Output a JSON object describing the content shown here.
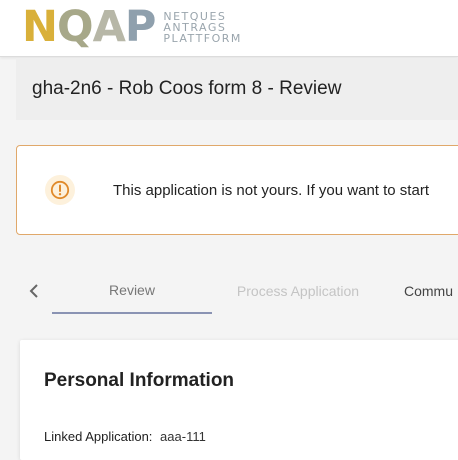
{
  "logo": {
    "letters": [
      "N",
      "Q",
      "A",
      "P"
    ],
    "text_lines": [
      "NETQUES",
      "ANTRAGS",
      "PLATTFORM"
    ],
    "colors": [
      "#d9b03a",
      "#a7a889",
      "#b7b7a7",
      "#8fa0ad"
    ]
  },
  "page": {
    "title": "gha-2n6 - Rob Coos form 8 - Review"
  },
  "alert": {
    "icon": "info-icon",
    "message": "This application is not yours. If you want to start",
    "accent_color": "#e0a86a"
  },
  "tabs": {
    "prev_icon": "chevron-left-icon",
    "items": [
      {
        "label": "Review",
        "state": "active"
      },
      {
        "label": "Process Application",
        "state": "disabled"
      },
      {
        "label": "Commu",
        "state": "normal"
      }
    ]
  },
  "section": {
    "title": "Personal Information",
    "fields": [
      {
        "label": "Linked Application:",
        "value": "aaa-111"
      }
    ]
  }
}
